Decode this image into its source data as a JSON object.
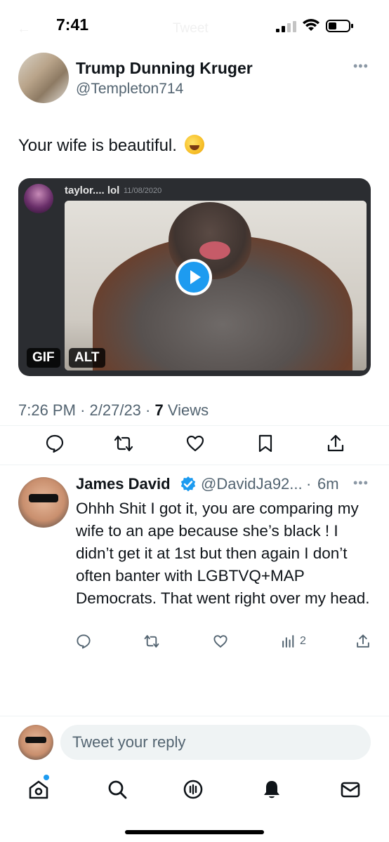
{
  "status_bar": {
    "time": "7:41",
    "ghost_title": "Tweet"
  },
  "main_tweet": {
    "display_name": "Trump Dunning Kruger",
    "handle": "@Templeton714",
    "text": "Your wife is beautiful.",
    "emoji_icon": "rolling-on-floor-laughing-emoji",
    "media": {
      "embedded_user": "taylor.... lol",
      "embedded_date": "11/08/2020",
      "gif_badge": "GIF",
      "alt_badge": "ALT"
    },
    "time": "7:26 PM",
    "dot1": "·",
    "date": "2/27/23",
    "dot2": "·",
    "views_count": "7",
    "views_label": "Views",
    "actions": [
      "reply-icon",
      "retweet-icon",
      "like-icon",
      "bookmark-icon",
      "share-icon"
    ]
  },
  "reply_tweet": {
    "display_name": "James David",
    "handle": "@DavidJa92...",
    "separator": "·",
    "time": "6m",
    "text": "Ohhh Shit I got it, you are comparing my wife to an ape because she’s black ! I didn’t get it at 1st but then again I don’t often banter with LGBTVQ+MAP Democrats.  That went right over my head.",
    "views_count": "2",
    "actions": [
      "reply-icon",
      "retweet-icon",
      "like-icon",
      "views-icon",
      "share-icon"
    ]
  },
  "composer": {
    "placeholder": "Tweet your reply"
  },
  "bottom_nav": {
    "items": [
      "home-icon",
      "search-icon",
      "spaces-icon",
      "notifications-icon",
      "messages-icon"
    ]
  },
  "colors": {
    "accent": "#1d9bf0",
    "text_primary": "#0f1419",
    "text_secondary": "#536471"
  }
}
